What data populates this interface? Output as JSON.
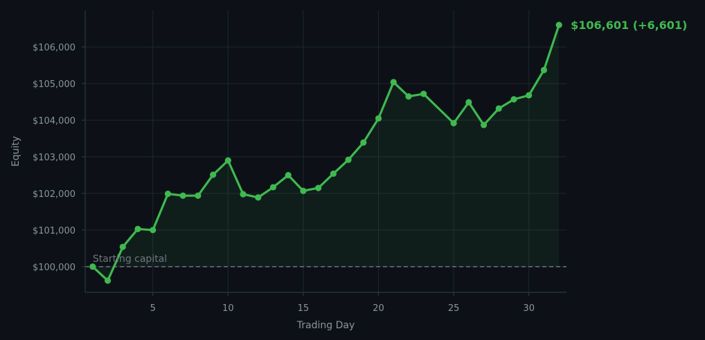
{
  "chart_data": {
    "type": "line",
    "xlabel": "Trading Day",
    "ylabel": "Equity",
    "xlim": [
      0.5,
      32.5
    ],
    "ylim": [
      99300,
      107000
    ],
    "x_ticks": [
      5,
      10,
      15,
      20,
      25,
      30
    ],
    "y_ticks": [
      100000,
      101000,
      102000,
      103000,
      104000,
      105000,
      106000
    ],
    "y_tick_labels": [
      "$100,000",
      "$101,000",
      "$102,000",
      "$103,000",
      "$104,000",
      "$105,000",
      "$106,000"
    ],
    "grid": true,
    "series": [
      {
        "color": "#3fb950",
        "x": [
          1,
          2,
          3,
          4,
          5,
          6,
          7,
          8,
          9,
          10,
          11,
          12,
          13,
          14,
          15,
          16,
          17,
          18,
          19,
          20,
          21,
          22,
          23,
          25,
          26,
          27,
          28,
          29,
          30,
          31,
          32
        ],
        "y": [
          100000,
          99620,
          100540,
          101030,
          101000,
          101990,
          101940,
          101940,
          102510,
          102900,
          101980,
          101890,
          102170,
          102500,
          102070,
          102150,
          102540,
          102920,
          103390,
          104050,
          105040,
          104650,
          104720,
          103920,
          104490,
          103870,
          104320,
          104570,
          104680,
          105370,
          106601
        ]
      }
    ],
    "reference_line": {
      "y": 100000,
      "label": "Starting capital",
      "color": "#6e7681"
    },
    "final_annotation": "$106,601  (+6,601)",
    "colors": {
      "background": "#0d1117",
      "line": "#3fb950",
      "fill": "#3fb950"
    }
  }
}
